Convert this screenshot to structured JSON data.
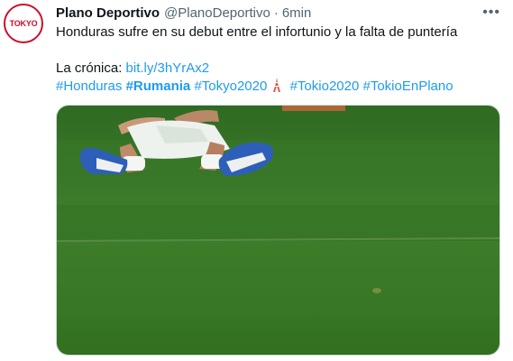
{
  "tweet": {
    "display_name": "Plano Deportivo",
    "handle": "@PlanoDeportivo",
    "separator": "·",
    "time": "6min",
    "more_label": "•••",
    "text_line1": "Honduras sufre en su debut entre el infortunio y la falta de puntería",
    "cronica_label": "La crónica: ",
    "link": "bit.ly/3hYrAx2",
    "hashtags": [
      "#Honduras",
      "#Rumania",
      "#Tokyo2020",
      "#Tokio2020",
      "#TokioEnPlano"
    ],
    "avatar_logo_text": "TOKYO",
    "emoji": "tokyo-tower-emoji"
  },
  "colors": {
    "link": "#1d9bf0",
    "secondary_text": "#536471",
    "primary_text": "#0f1419",
    "avatar_accent": "#c8102e",
    "grass": "#3d7a2a"
  }
}
